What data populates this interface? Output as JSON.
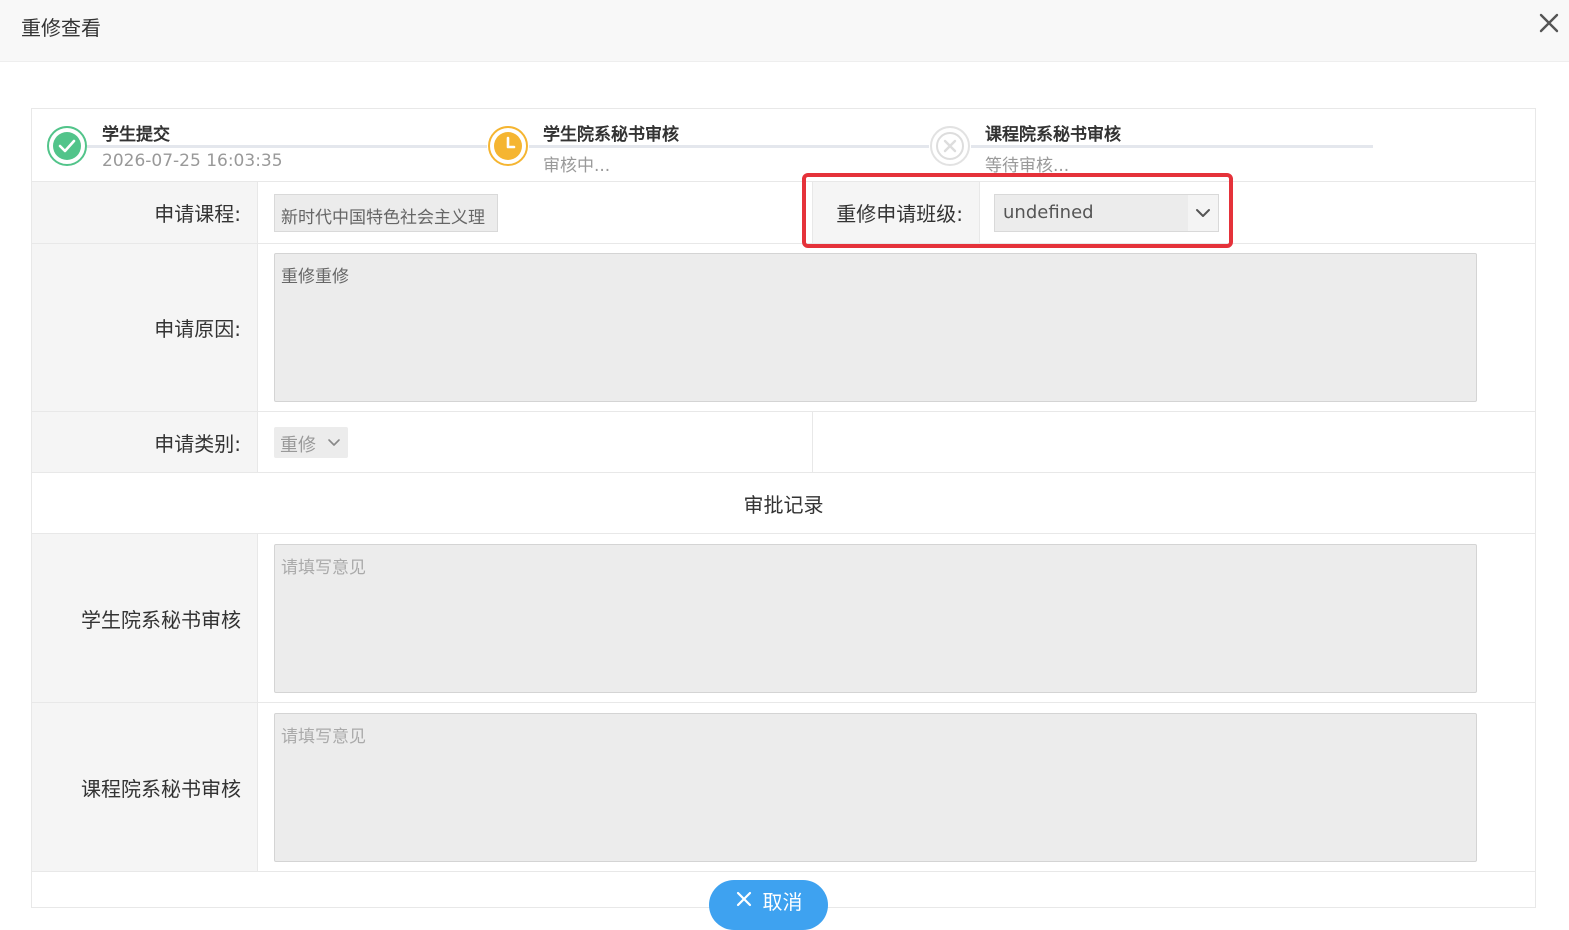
{
  "dialog": {
    "title": "重修查看",
    "close_icon": "close-icon"
  },
  "steps": [
    {
      "title": "学生提交",
      "subtitle": "2026-07-25 16:03:35",
      "status": "done",
      "icon": "check-circle-icon",
      "color": "#52c48a"
    },
    {
      "title": "学生院系秘书审核",
      "subtitle": "审核中...",
      "status": "in-progress",
      "icon": "clock-icon",
      "color": "#f5b531"
    },
    {
      "title": "课程院系秘书审核",
      "subtitle": "等待审核...",
      "status": "waiting",
      "icon": "x-circle-icon",
      "color": "#dddddd"
    }
  ],
  "form": {
    "course_label": "申请课程:",
    "course_value": "新时代中国特色社会主义理",
    "class_label": "重修申请班级:",
    "class_value": "undefined",
    "reason_label": "申请原因:",
    "reason_value": "重修重修",
    "type_label": "申请类别:",
    "type_value": "重修"
  },
  "approval": {
    "section_title": "审批记录",
    "student_dept_label": "学生院系秘书审核",
    "student_dept_placeholder": "请填写意见",
    "course_dept_label": "课程院系秘书审核",
    "course_dept_placeholder": "请填写意见"
  },
  "footer": {
    "cancel_label": "取消"
  }
}
